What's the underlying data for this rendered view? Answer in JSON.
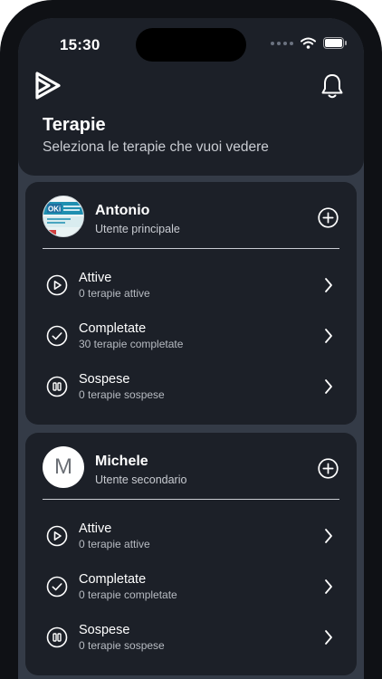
{
  "status": {
    "time": "15:30"
  },
  "header": {
    "title": "Terapie",
    "subtitle": "Seleziona le terapie che vuoi vedere"
  },
  "users": [
    {
      "name": "Antonio",
      "role": "Utente principale",
      "avatar_letter": "",
      "rows": [
        {
          "label": "Attive",
          "sub": "0 terapie attive"
        },
        {
          "label": "Completate",
          "sub": "30 terapie completate"
        },
        {
          "label": "Sospese",
          "sub": "0 terapie sospese"
        }
      ]
    },
    {
      "name": "Michele",
      "role": "Utente secondario",
      "avatar_letter": "M",
      "rows": [
        {
          "label": "Attive",
          "sub": "0 terapie attive"
        },
        {
          "label": "Completate",
          "sub": "0 terapie completate"
        },
        {
          "label": "Sospese",
          "sub": "0 terapie sospese"
        }
      ]
    }
  ],
  "avatar_image_text": "OKi",
  "colors": {
    "background": "#343b47",
    "card": "#1c2028",
    "text": "#ffffff",
    "secondary_text": "#c9ccd2"
  },
  "icons": {
    "logo": "play-logo-icon",
    "notifications": "bell-icon",
    "add": "plus-circle-icon",
    "active": "play-circle-icon",
    "completed": "check-circle-icon",
    "suspended": "pause-circle-icon",
    "chevron": "chevron-right-icon"
  }
}
